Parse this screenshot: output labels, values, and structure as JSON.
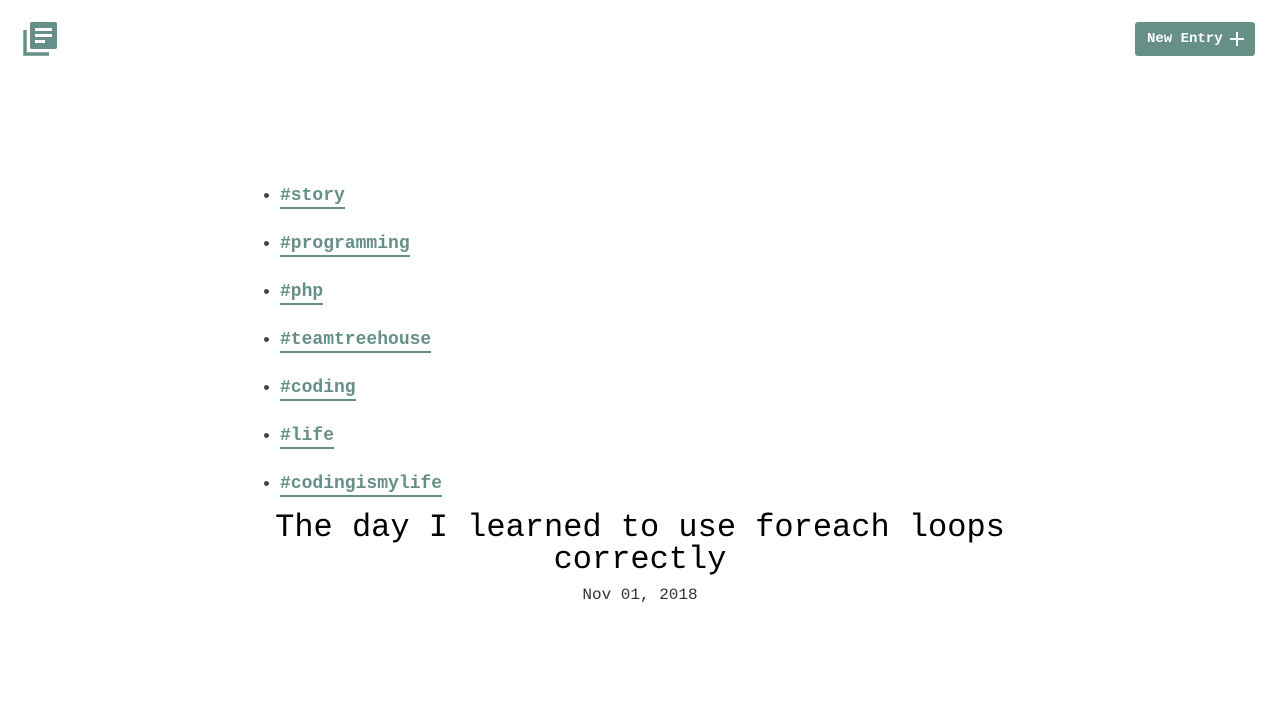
{
  "header": {
    "logo_icon": "journal-icon",
    "new_entry_label": "New Entry",
    "new_entry_icon": "plus-icon",
    "accent_color": "#668f87"
  },
  "tags": [
    "#story",
    "#programming",
    "#php",
    "#teamtreehouse",
    "#coding",
    "#life",
    "#codingismylife"
  ],
  "entry": {
    "title": "The day I learned to use foreach loops correctly",
    "date": "Nov 01, 2018"
  }
}
